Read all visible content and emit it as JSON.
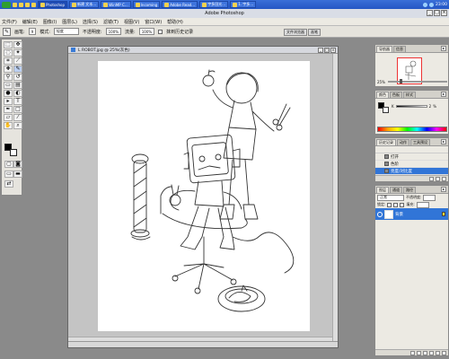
{
  "taskbar": {
    "buttons": [
      "",
      "",
      "",
      "",
      "",
      "",
      "",
      "",
      "",
      "",
      ""
    ],
    "items": [
      {
        "label": "Photoshop"
      },
      {
        "label": "新建 文本…"
      },
      {
        "label": "WinMP C…"
      },
      {
        "label": "Incoming"
      },
      {
        "label": "Adobe Read…"
      },
      {
        "label": "宇多田光…"
      },
      {
        "label": "1. 宇多…"
      }
    ],
    "clock": "23:00"
  },
  "app_title": "Adobe Photoshop",
  "menu": [
    "文件(F)",
    "编辑(E)",
    "图像(I)",
    "图层(L)",
    "选择(S)",
    "滤镜(T)",
    "视图(V)",
    "窗口(W)",
    "帮助(H)"
  ],
  "options": {
    "brush_label": "画笔:",
    "brush_size": "9",
    "mode_label": "模式:",
    "mode_value": "轻度",
    "opacity_label": "不透明度:",
    "opacity_value": "100%",
    "flow_label": "流量:",
    "flow_value": "100%",
    "history_check_label": "抹到历史记录"
  },
  "well_tabs": [
    "文件浏览器",
    "画笔"
  ],
  "document": {
    "title": "L ROBOT.jpg @ 25%(灰色)"
  },
  "navigator": {
    "tabs": [
      "导航器",
      "信息"
    ],
    "zoom": "25%"
  },
  "color_panel": {
    "tabs": [
      "颜色",
      "色板",
      "样式"
    ],
    "k_label": "K",
    "k_value": "2",
    "k_unit": "%"
  },
  "history": {
    "tabs": [
      "历史记录",
      "动作",
      "工具预设"
    ],
    "items": [
      {
        "label": "打开"
      },
      {
        "label": "色阶"
      },
      {
        "label": "亮度/对比度"
      }
    ]
  },
  "layers": {
    "tabs": [
      "图层",
      "通道",
      "路径"
    ],
    "blend_mode": "正常",
    "opacity_label": "不透明度:",
    "lock_label": "锁定:",
    "fill_label": "填充:",
    "layer_name": "背景"
  },
  "colors": {
    "accent": "#3175d7",
    "taskbar": "#2456c4",
    "workspace": "#8a8a8a"
  }
}
